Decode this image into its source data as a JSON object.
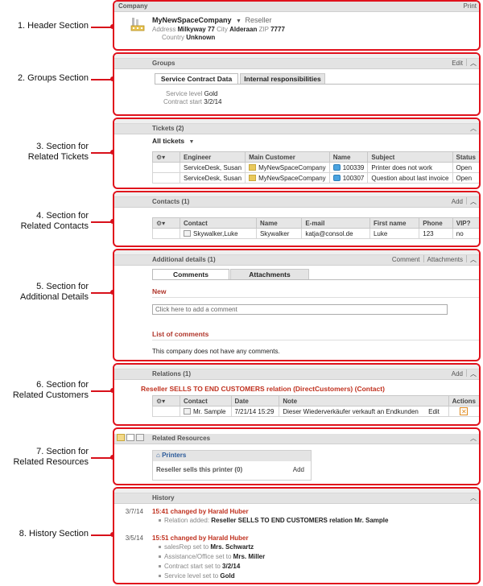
{
  "callouts": [
    {
      "text": "1. Header Section"
    },
    {
      "text": "2. Groups Section"
    },
    {
      "text": "3. Section for\nRelated Tickets"
    },
    {
      "text": "4. Section for\nRelated Contacts"
    },
    {
      "text": "5. Section for\nAdditional Details"
    },
    {
      "text": "6. Section for\nRelated Customers"
    },
    {
      "text": "7. Section for\nRelated Resources"
    },
    {
      "text": "8. History Section"
    }
  ],
  "header": {
    "title": "Company",
    "print": "Print",
    "company_name": "MyNewSpaceCompany",
    "type": "Reseller",
    "address_label": "Address",
    "address": "Milkyway 77",
    "city_label": "City",
    "city": "Alderaan",
    "zip_label": "ZIP",
    "zip": "7777",
    "country_label": "Country",
    "country": "Unknown"
  },
  "groups": {
    "title": "Groups",
    "edit": "Edit",
    "tabs": [
      "Service Contract Data",
      "Internal responsibilities"
    ],
    "service_level_label": "Service level",
    "service_level": "Gold",
    "contract_start_label": "Contract start",
    "contract_start": "3/2/14"
  },
  "tickets": {
    "title": "Tickets (2)",
    "filter": "All tickets",
    "columns": [
      "Engineer",
      "Main Customer",
      "Name",
      "Subject",
      "Status"
    ],
    "rows": [
      {
        "engineer": "ServiceDesk, Susan",
        "customer": "MyNewSpaceCompany",
        "name": "100339",
        "subject": "Printer does not work",
        "status": "Open"
      },
      {
        "engineer": "ServiceDesk, Susan",
        "customer": "MyNewSpaceCompany",
        "name": "100307",
        "subject": "Question about last invoice",
        "status": "Open"
      }
    ]
  },
  "contacts": {
    "title": "Contacts (1)",
    "add": "Add",
    "columns": [
      "Contact",
      "Name",
      "E-mail",
      "First name",
      "Phone",
      "VIP?"
    ],
    "rows": [
      {
        "contact": "Skywalker,Luke",
        "name": "Skywalker",
        "email": "katja@consol.de",
        "first_name": "Luke",
        "phone": "123",
        "vip": "no"
      }
    ]
  },
  "details": {
    "title": "Additional details (1)",
    "comment": "Comment",
    "attachments": "Attachments",
    "tabs": [
      "Comments",
      "Attachments"
    ],
    "new_label": "New",
    "placeholder": "Click here to add a comment",
    "list_label": "List of comments",
    "empty": "This company does not have any comments."
  },
  "relations": {
    "title": "Relations (1)",
    "add": "Add",
    "heading": "Reseller SELLS TO END CUSTOMERS relation (DirectCustomers) (Contact)",
    "columns": [
      "Contact",
      "Date",
      "Note",
      "Actions"
    ],
    "rows": [
      {
        "contact": "Mr. Sample",
        "date": "7/21/14 15:29",
        "note": "Dieser Wiederverkäufer verkauft an Endkunden",
        "edit": "Edit",
        "delete": "✕"
      }
    ]
  },
  "resources": {
    "title": "Related Resources",
    "group": "Printers",
    "line": "Reseller sells this printer (0)",
    "add": "Add"
  },
  "history": {
    "title": "History",
    "entries": [
      {
        "date": "3/7/14",
        "headline": "15:41 changed by Harald Huber",
        "items": [
          {
            "prefix": "Relation added: ",
            "value": "Reseller SELLS TO END CUSTOMERS relation Mr. Sample"
          }
        ]
      },
      {
        "date": "3/5/14",
        "headline": "15:51 changed by Harald Huber",
        "items": [
          {
            "prefix": "salesRep set to ",
            "value": "Mrs. Schwartz"
          },
          {
            "prefix": "Assistance/Office set to ",
            "value": "Mrs. Miller"
          },
          {
            "prefix": "Contract start set to ",
            "value": "3/2/14"
          },
          {
            "prefix": "Service level set to ",
            "value": "Gold"
          }
        ]
      }
    ]
  },
  "colors": {
    "accent": "#e0111c",
    "section_header": "#e3e3e3",
    "link_red": "#c0311f"
  }
}
